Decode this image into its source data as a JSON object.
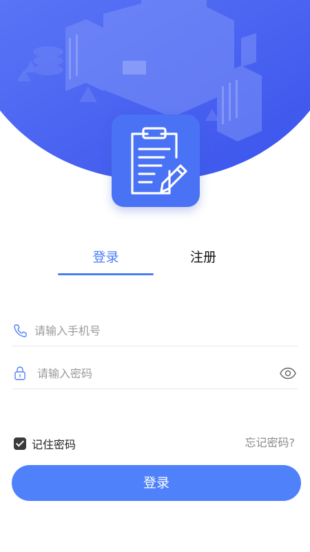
{
  "tabs": {
    "login": "登录",
    "register": "注册",
    "active": "login"
  },
  "form": {
    "phone_placeholder": "请输入手机号",
    "phone_value": "",
    "password_placeholder": "请输入密码",
    "password_value": ""
  },
  "options": {
    "remember_label": "记住密码",
    "remember_checked": true,
    "forgot_label": "忘记密码?"
  },
  "actions": {
    "login_button": "登录"
  },
  "icons": {
    "phone": "phone-icon",
    "lock": "lock-icon",
    "eye": "eye-icon",
    "logo": "clipboard-pen-icon"
  },
  "colors": {
    "primary": "#4f81fb",
    "hero_blue": "#3f5ef3",
    "active_tab": "#4a7bf7"
  }
}
